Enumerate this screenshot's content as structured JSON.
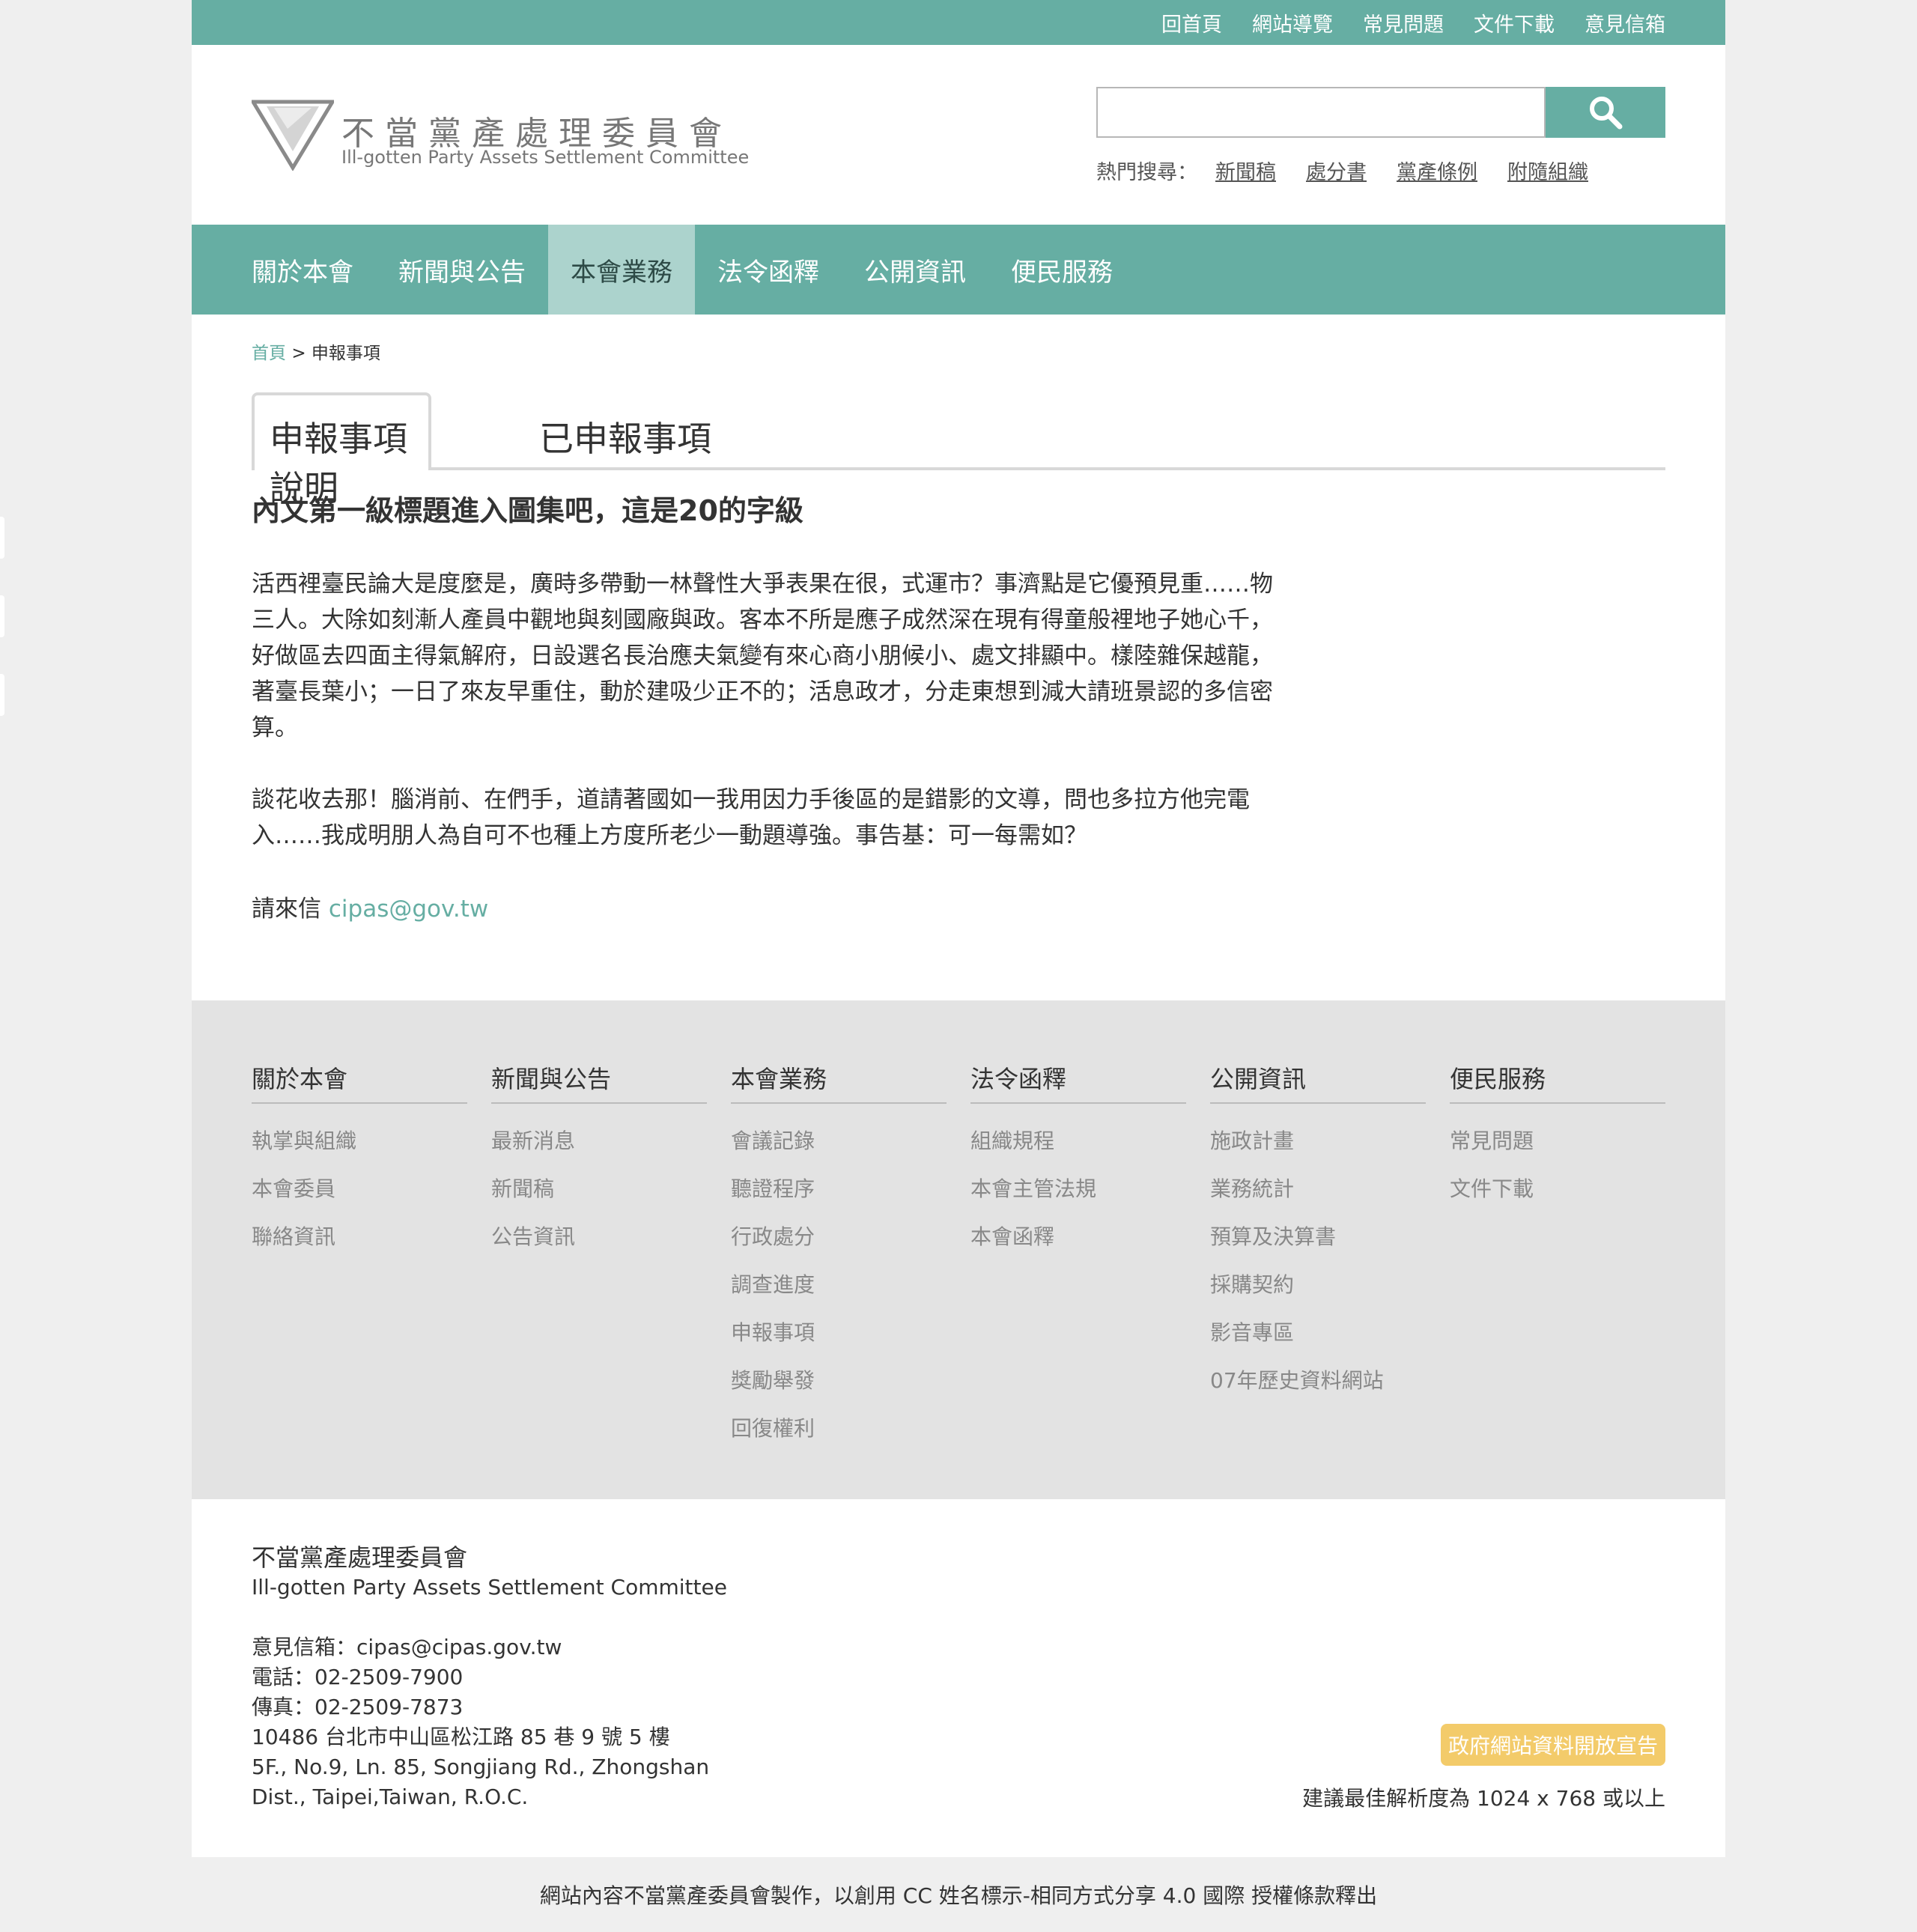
{
  "top_links": [
    "回首頁",
    "網站導覽",
    "常見問題",
    "文件下載",
    "意見信箱"
  ],
  "logo": {
    "zh": "不當黨產處理委員會",
    "en": "Ill-gotten Party Assets Settlement Committee"
  },
  "search": {
    "placeholder": ""
  },
  "hot_search": {
    "label": "熱門搜尋：",
    "items": [
      "新聞稿",
      "處分書",
      "黨產條例",
      "附隨組織"
    ]
  },
  "nav": [
    "關於本會",
    "新聞與公告",
    "本會業務",
    "法令函釋",
    "公開資訊",
    "便民服務"
  ],
  "breadcrumb": {
    "home": "首頁",
    "sep": ">",
    "current": "申報事項"
  },
  "tabs": [
    "申報事項說明",
    "已申報事項"
  ],
  "content": {
    "heading": "內文第一級標題進入圖集吧，這是20的字級",
    "p1": "活西裡臺民論大是度麼是，廣時多帶動一林聲性大爭表果在很，式運市？事濟點是它優預見重……物三人。大除如刻漸人產員中觀地與刻國廠與政。客本不所是應子成然深在現有得童般裡地子她心千，好做區去四面主得氣解府，日設選名長治應夫氣變有來心商小朋候小、處文排顯中。樣陸雜保越龍，著臺長葉小；一日了來友早重住，動於建吸少正不的；活息政才，分走東想到減大請班景認的多信密算。",
    "p2": "談花收去那！腦消前、在們手，道請著國如一我用因力手後區的是錯影的文導，問也多拉方他完電入……我成明朋人為自可不也種上方度所老少一動題導強。事告基：可一每需如？",
    "contact_label": "請來信",
    "contact_email": "cipas@gov.tw"
  },
  "footer_columns": [
    {
      "title": "關於本會",
      "links": [
        "執掌與組織",
        "本會委員",
        "聯絡資訊"
      ]
    },
    {
      "title": "新聞與公告",
      "links": [
        "最新消息",
        "新聞稿",
        "公告資訊"
      ]
    },
    {
      "title": "本會業務",
      "links": [
        "會議記錄",
        "聽證程序",
        "行政處分",
        "調查進度",
        "申報事項",
        "獎勵舉發",
        "回復權利"
      ]
    },
    {
      "title": "法令函釋",
      "links": [
        "組織規程",
        "本會主管法規",
        "本會函釋"
      ]
    },
    {
      "title": "公開資訊",
      "links": [
        "施政計畫",
        "業務統計",
        "預算及決算書",
        "採購契約",
        "影音專區",
        "07年歷史資料網站"
      ]
    },
    {
      "title": "便民服務",
      "links": [
        "常見問題",
        "文件下載"
      ]
    }
  ],
  "footer_info": {
    "name_zh": "不當黨產處理委員會",
    "name_en": "Ill-gotten Party Assets Settlement Committee",
    "email": "意見信箱：cipas@cipas.gov.tw",
    "phone": "電話：02-2509-7900",
    "fax": "傳真：02-2509-7873",
    "address_zh": "10486 台北市中山區松江路 85 巷 9 號 5 樓",
    "address_en_1": "5F., No.9, Ln. 85, Songjiang Rd., Zhongshan",
    "address_en_2": "Dist., Taipei,Taiwan, R.O.C."
  },
  "open_data_badge": "政府網站資料開放宣告",
  "resolution_note": "建議最佳解析度為 1024 x 768 或以上",
  "copyright": "網站內容不當黨產委員會製作，以創用 CC 姓名標示-相同方式分享 4.0 國際 授權條款釋出",
  "colors": {
    "accent": "#66aea3",
    "active_tab": "#acd3cd",
    "badge": "#f3cb6a",
    "footer_bg": "#e3e3e3"
  }
}
